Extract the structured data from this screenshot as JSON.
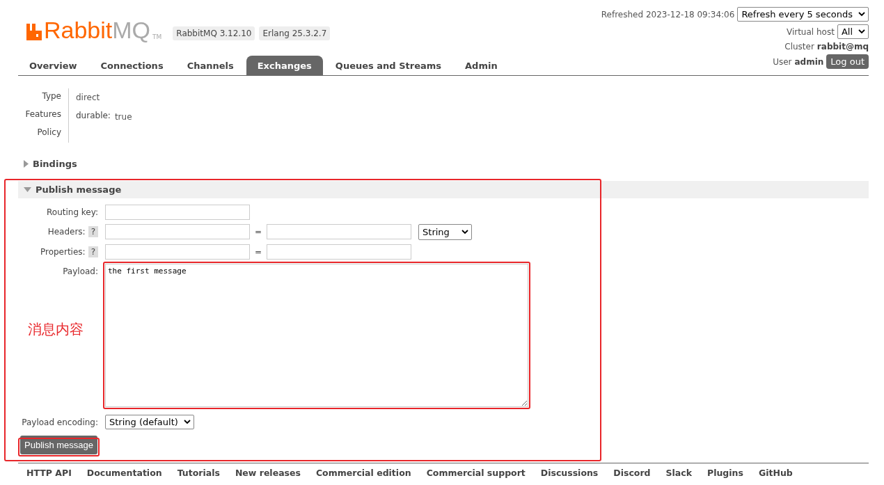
{
  "header": {
    "logo": {
      "brand": "Rabbit",
      "suffix": "MQ",
      "tm": "TM"
    },
    "versions": [
      "RabbitMQ 3.12.10",
      "Erlang 25.3.2.7"
    ],
    "refreshed": "Refreshed 2023-12-18 09:34:06",
    "refresh_select": "Refresh every 5 seconds",
    "virtual_host": {
      "label": "Virtual host",
      "value": "All"
    },
    "cluster": {
      "label": "Cluster",
      "value": "rabbit@mq"
    },
    "user": {
      "label": "User",
      "value": "admin"
    },
    "logout": "Log out"
  },
  "tabs": [
    {
      "label": "Overview",
      "selected": false
    },
    {
      "label": "Connections",
      "selected": false
    },
    {
      "label": "Channels",
      "selected": false
    },
    {
      "label": "Exchanges",
      "selected": true
    },
    {
      "label": "Queues and Streams",
      "selected": false
    },
    {
      "label": "Admin",
      "selected": false
    }
  ],
  "details": [
    {
      "label": "Type",
      "value": "direct"
    },
    {
      "label": "Features",
      "key": "durable:",
      "value": "true"
    },
    {
      "label": "Policy"
    }
  ],
  "bindings": {
    "title": "Bindings",
    "expanded": false
  },
  "publish": {
    "title": "Publish message",
    "expanded": true,
    "routing_key": {
      "label": "Routing key:"
    },
    "headers": {
      "label": "Headers:",
      "help": "?",
      "equals": "=",
      "type": "String"
    },
    "properties": {
      "label": "Properties:",
      "help": "?",
      "equals": "="
    },
    "payload": {
      "label": "Payload:",
      "value": "the first message"
    },
    "encoding": {
      "label": "Payload encoding:",
      "value": "String (default)"
    },
    "button": "Publish message"
  },
  "annotation": {
    "label": "消息内容"
  },
  "footer_links": [
    "HTTP API",
    "Documentation",
    "Tutorials",
    "New releases",
    "Commercial edition",
    "Commercial support",
    "Discussions",
    "Discord",
    "Slack",
    "Plugins",
    "GitHub"
  ]
}
